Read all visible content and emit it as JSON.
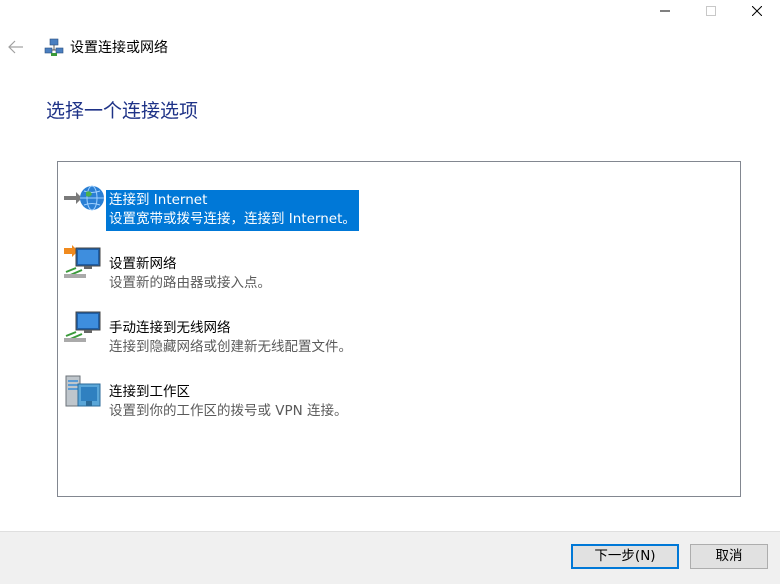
{
  "window": {
    "title": "设置连接或网络",
    "controls": [
      "minimize-icon",
      "maximize-icon",
      "close-icon"
    ]
  },
  "heading": "选择一个连接选项",
  "options": [
    {
      "title": "连接到 Internet",
      "description": "设置宽带或拨号连接，连接到 Internet。",
      "icon": "globe-icon",
      "selected": true
    },
    {
      "title": "设置新网络",
      "description": "设置新的路由器或接入点。",
      "icon": "new-network-icon",
      "selected": false
    },
    {
      "title": "手动连接到无线网络",
      "description": "连接到隐藏网络或创建新无线配置文件。",
      "icon": "wireless-network-icon",
      "selected": false
    },
    {
      "title": "连接到工作区",
      "description": "设置到你的工作区的拨号或 VPN 连接。",
      "icon": "workplace-icon",
      "selected": false
    }
  ],
  "buttons": {
    "next": "下一步(N)",
    "cancel": "取消"
  },
  "colors": {
    "heading": "#1e3287",
    "selection": "#0078d7",
    "footer": "#f0f0f0"
  }
}
